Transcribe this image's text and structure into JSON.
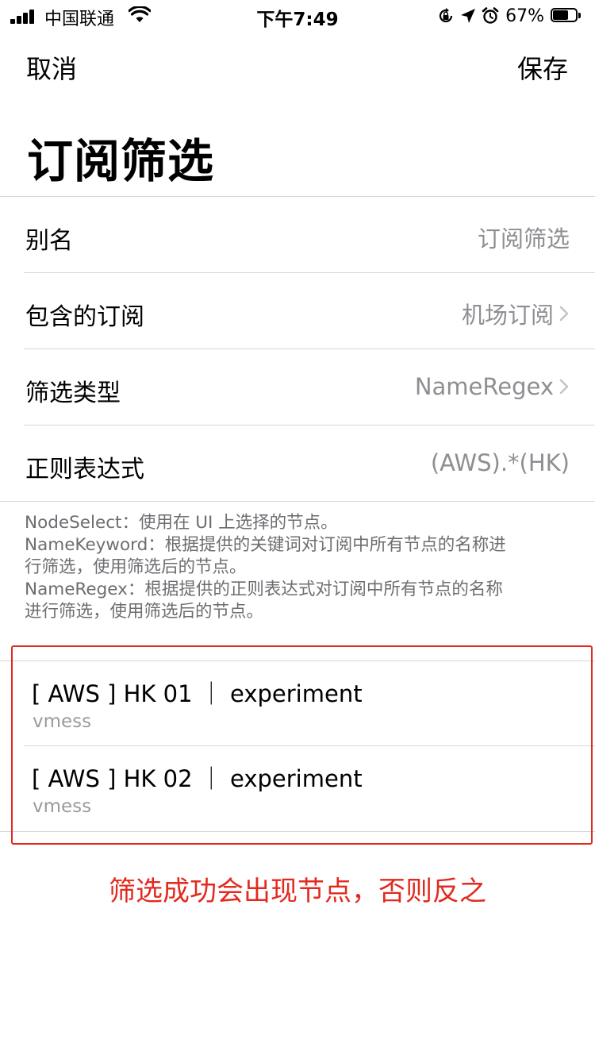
{
  "status_bar": {
    "carrier": "中国联通",
    "time": "下午7:49",
    "battery_percent": "67%",
    "battery_level": 0.67
  },
  "nav": {
    "cancel_label": "取消",
    "save_label": "保存"
  },
  "page": {
    "title": "订阅筛选"
  },
  "form": {
    "rows": [
      {
        "label": "别名",
        "value": "订阅筛选",
        "has_chevron": false
      },
      {
        "label": "包含的订阅",
        "value": "机场订阅",
        "has_chevron": true
      },
      {
        "label": "筛选类型",
        "value": "NameRegex",
        "has_chevron": true
      },
      {
        "label": "正则表达式",
        "value": "(AWS).*(HK)",
        "has_chevron": false
      }
    ]
  },
  "help": {
    "lines": [
      "NodeSelect：使用在 UI 上选择的节点。",
      "NameKeyword：根据提供的关键词对订阅中所有节点的名称进",
      "行筛选，使用筛选后的节点。",
      "NameRegex：根据提供的正则表达式对订阅中所有节点的名称",
      "进行筛选，使用筛选后的节点。"
    ]
  },
  "nodes": [
    {
      "name": "[ AWS ] HK 01 ｜ experiment",
      "type": "vmess"
    },
    {
      "name": "[ AWS ] HK 02 ｜ experiment",
      "type": "vmess"
    }
  ],
  "annotation": {
    "text": "筛选成功会出现节点，否则反之"
  },
  "colors": {
    "annotation_red": "#e22a1f",
    "secondary_text": "#8e8e93",
    "separator": "#d6d6d6"
  },
  "icons": [
    "signal-icon",
    "wifi-icon",
    "orientation-lock-icon",
    "location-arrow-icon",
    "alarm-icon",
    "battery-icon",
    "chevron-right-icon"
  ]
}
